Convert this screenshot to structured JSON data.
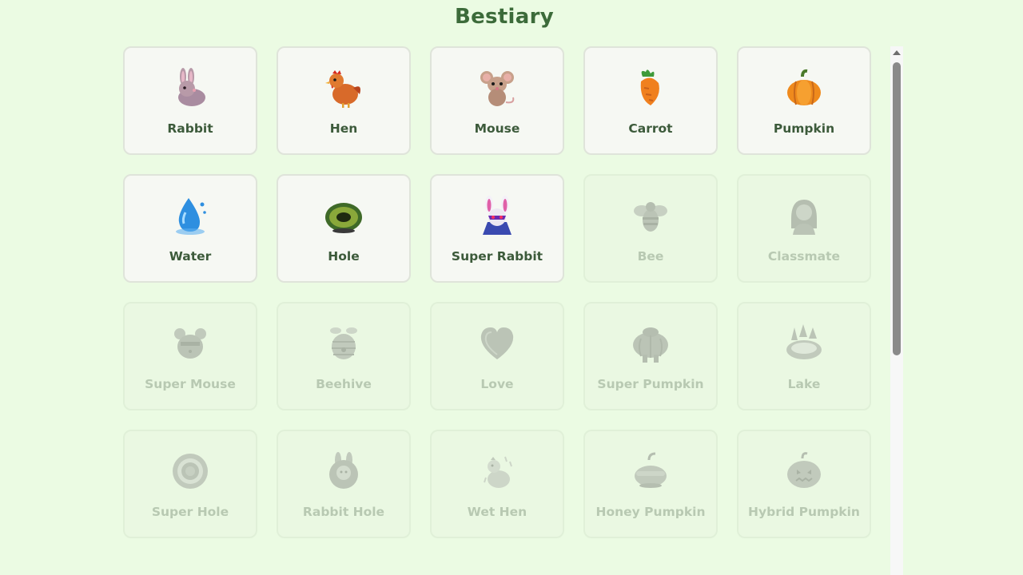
{
  "title": "Bestiary",
  "cards": [
    {
      "label": "Rabbit",
      "icon": "rabbit-icon",
      "unlocked": true
    },
    {
      "label": "Hen",
      "icon": "hen-icon",
      "unlocked": true
    },
    {
      "label": "Mouse",
      "icon": "mouse-icon",
      "unlocked": true
    },
    {
      "label": "Carrot",
      "icon": "carrot-icon",
      "unlocked": true
    },
    {
      "label": "Pumpkin",
      "icon": "pumpkin-icon",
      "unlocked": true
    },
    {
      "label": "Water",
      "icon": "water-drop-icon",
      "unlocked": true
    },
    {
      "label": "Hole",
      "icon": "hole-icon",
      "unlocked": true
    },
    {
      "label": "Super Rabbit",
      "icon": "super-rabbit-icon",
      "unlocked": true
    },
    {
      "label": "Bee",
      "icon": "bee-icon",
      "unlocked": false
    },
    {
      "label": "Classmate",
      "icon": "classmate-icon",
      "unlocked": false
    },
    {
      "label": "Super Mouse",
      "icon": "super-mouse-icon",
      "unlocked": false
    },
    {
      "label": "Beehive",
      "icon": "beehive-icon",
      "unlocked": false
    },
    {
      "label": "Love",
      "icon": "heart-icon",
      "unlocked": false
    },
    {
      "label": "Super Pumpkin",
      "icon": "super-pumpkin-icon",
      "unlocked": false
    },
    {
      "label": "Lake",
      "icon": "lake-icon",
      "unlocked": false
    },
    {
      "label": "Super Hole",
      "icon": "super-hole-icon",
      "unlocked": false
    },
    {
      "label": "Rabbit Hole",
      "icon": "rabbit-hole-icon",
      "unlocked": false
    },
    {
      "label": "Wet Hen",
      "icon": "wet-hen-icon",
      "unlocked": false
    },
    {
      "label": "Honey Pumpkin",
      "icon": "honey-pumpkin-icon",
      "unlocked": false
    },
    {
      "label": "Hybrid Pumpkin",
      "icon": "hybrid-pumpkin-icon",
      "unlocked": false
    }
  ],
  "colors": {
    "background": "#ebfbe3",
    "title": "#3c6b3a",
    "card_unlocked": "#f6f8f3",
    "card_locked": "#eaf8e2",
    "label_unlocked": "#3c5a3a",
    "label_locked": "#b8c9b2"
  }
}
